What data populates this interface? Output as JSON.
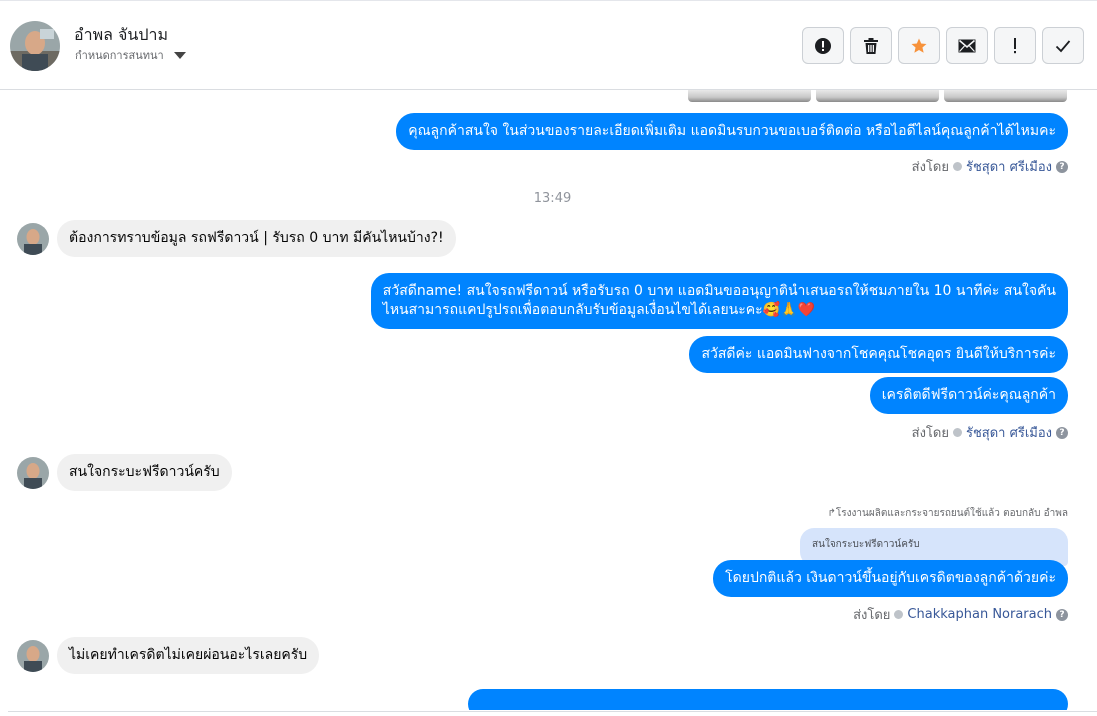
{
  "header": {
    "contact_name": "อำพล จันปาม",
    "assign_label": "กำหนดการสนทนา"
  },
  "toolbar": {
    "icons": [
      "alert-circle-icon",
      "trash-icon",
      "star-icon",
      "mail-icon",
      "exclamation-icon",
      "check-icon"
    ],
    "star_color": "#f7923b"
  },
  "colors": {
    "outgoing_bubble": "#0084ff",
    "incoming_bubble": "#f0f0f0",
    "quoted_bubble": "#d6e4fb"
  },
  "messages": {
    "out1": "คุณลูกค้าสนใจ ในส่วนของรายละเอียดเพิ่มเติม แอดมินรบกวนขอเบอร์ติดต่อ หรือไอดีไลน์คุณลูกค้าได้ไหมคะ",
    "sentby1_prefix": "ส่งโดย",
    "sentby1_name": "รัชสุดา ศรีเมือง",
    "timestamp": "13:49",
    "in1": "ต้องการทราบข้อมูล รถฟรีดาวน์ | รับรถ 0 บาท มีคันไหนบ้าง?!",
    "out2_line1": "สวัสดีname! สนใจรถฟรีดาวน์ หรือรับรถ 0 บาท แอดมินขออนุญาตินำเสนอรถให้ชมภายใน 10 นาทีค่ะ สนใจคัน",
    "out2_line2": "ไหนสามารถแคปรูปรถเพื่อตอบกลับรับข้อมูลเงื่อนไขได้เลยนะคะ🥰🙏❤️",
    "out3": "สวัสดีค่ะ แอดมินฟางจากโชคคุณโชคอุดร ยินดีให้บริการค่ะ",
    "out4": "เครดิตดีฟรีดาวน์ค่ะคุณลูกค้า",
    "sentby2_prefix": "ส่งโดย",
    "sentby2_name": "รัชสุดา ศรีเมือง",
    "in2": "สนใจกระบะฟรีดาวน์ครับ",
    "reply_label": "↱โรงงานผลิตและกระจายรถยนต์ใช้แล้ว ตอบกลับ อำพล",
    "quoted_text": "สนใจกระบะฟรีดาวน์ครับ",
    "out5": "โดยปกติแล้ว เงินดาวน์ขึ้นอยู่กับเครดิตของลูกค้าด้วยค่ะ",
    "sentby3_prefix": "ส่งโดย",
    "sentby3_name": "Chakkaphan Norarach",
    "in3": "ไม่เคยทำเครดิตไม่เคยผ่อนอะไรเลยครับ"
  }
}
